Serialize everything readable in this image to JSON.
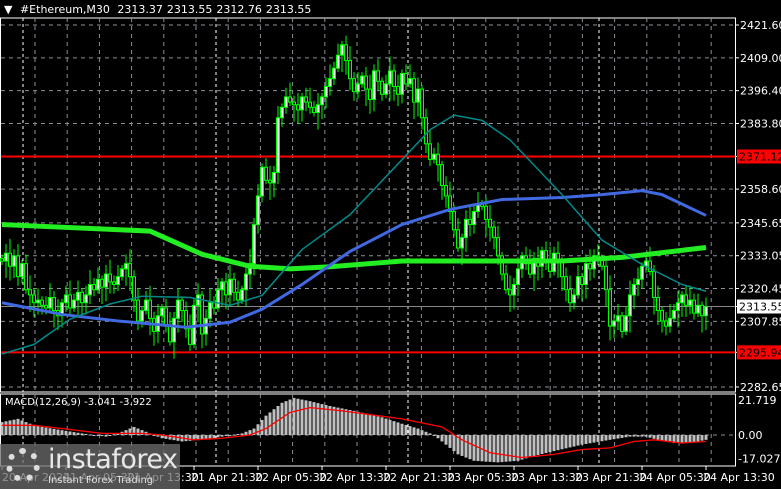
{
  "header": {
    "collapse_icon": "triangle-down-icon",
    "symbol": "#Ethereum,M30",
    "open": "2313.37",
    "high": "2313.55",
    "low": "2312.76",
    "close": "2313.55"
  },
  "watermark": {
    "brand": "instaforex",
    "tagline": "Instant Forex Trading"
  },
  "colors": {
    "bg": "#000000",
    "bull": "#00ff00",
    "ma_slow": "#22ee22",
    "ma_mid": "#4169e1",
    "ma_fast": "#008b8b",
    "level": "#ff0000",
    "hist": "#c0c0c0",
    "signal": "#ff0000",
    "grid": "#8a8f99"
  },
  "chart_data": {
    "type": "candlestick",
    "title": "#Ethereum,M30",
    "ylim": [
      2282.65,
      2421.6
    ],
    "y_ticks": [
      "2421.60",
      "2409.00",
      "2396.40",
      "2383.80",
      "2371.12",
      "2358.60",
      "2345.65",
      "2333.05",
      "2320.45",
      "2313.55",
      "2307.85",
      "2295.94",
      "2282.65"
    ],
    "y_tick_values": [
      2421.6,
      2409.0,
      2396.4,
      2383.8,
      2371.12,
      2358.6,
      2345.65,
      2333.05,
      2320.45,
      2313.55,
      2307.85,
      2295.94,
      2282.65
    ],
    "highlight_labels": {
      "2371.12": "level",
      "2295.94": "level",
      "2313.55": "price"
    },
    "levels": [
      2371.12,
      2295.94
    ],
    "current_price": 2313.55,
    "x_labels": [
      "20 Apr 2024",
      "21 Apr 05:30",
      "21 Apr 13:30",
      "21 Apr 21:30",
      "22 Apr 05:30",
      "22 Apr 13:30",
      "22 Apr 21:30",
      "23 Apr 05:30",
      "23 Apr 13:30",
      "23 Apr 21:30",
      "24 Apr 05:30",
      "24 Apr 13:30"
    ],
    "x_label_candle_index": [
      0,
      16,
      32,
      48,
      64,
      80,
      96,
      112,
      128,
      144,
      160,
      176
    ],
    "closes": [
      2331,
      2334,
      2329,
      2333,
      2325,
      2330,
      2320,
      2318,
      2315,
      2316,
      2314,
      2313,
      2317,
      2312,
      2310,
      2315,
      2318,
      2313,
      2316,
      2319,
      2315,
      2318,
      2322,
      2320,
      2324,
      2321,
      2326,
      2323,
      2322,
      2325,
      2328,
      2330,
      2325,
      2316,
      2308,
      2312,
      2316,
      2309,
      2304,
      2310,
      2313,
      2306,
      2300,
      2309,
      2316,
      2312,
      2305,
      2299,
      2314,
      2318,
      2303,
      2309,
      2315,
      2313,
      2320,
      2323,
      2318,
      2324,
      2319,
      2316,
      2320,
      2326,
      2330,
      2345,
      2356,
      2367,
      2362,
      2361,
      2365,
      2386,
      2390,
      2394,
      2392,
      2391,
      2389,
      2394,
      2392,
      2390,
      2388,
      2391,
      2394,
      2398,
      2401,
      2405,
      2410,
      2414,
      2408,
      2401,
      2396,
      2399,
      2402,
      2397,
      2393,
      2404,
      2400,
      2395,
      2399,
      2404,
      2398,
      2395,
      2403,
      2399,
      2401,
      2392,
      2397,
      2386,
      2376,
      2370,
      2372,
      2368,
      2360,
      2356,
      2350,
      2343,
      2336,
      2340,
      2347,
      2345,
      2350,
      2353,
      2352,
      2347,
      2344,
      2340,
      2333,
      2326,
      2320,
      2318,
      2322,
      2328,
      2333,
      2330,
      2326,
      2332,
      2329,
      2335,
      2331,
      2327,
      2334,
      2331,
      2325,
      2320,
      2315,
      2318,
      2325,
      2322,
      2330,
      2328,
      2333,
      2332,
      2329,
      2320,
      2306,
      2308,
      2310,
      2304,
      2310,
      2318,
      2322,
      2324,
      2329,
      2331,
      2327,
      2317,
      2312,
      2308,
      2306,
      2309,
      2312,
      2315,
      2318,
      2314,
      2316,
      2311,
      2314,
      2310,
      2313.55
    ],
    "moving_averages": [
      {
        "name": "slow",
        "points": [
          [
            0,
            2345
          ],
          [
            37,
            2342.5
          ],
          [
            50,
            2333.6
          ],
          [
            62,
            2329
          ],
          [
            72,
            2328
          ],
          [
            82,
            2328.8
          ],
          [
            100,
            2331
          ],
          [
            115,
            2331
          ],
          [
            140,
            2331
          ],
          [
            155,
            2332.4
          ],
          [
            176,
            2336.2
          ]
        ]
      },
      {
        "name": "mid",
        "points": [
          [
            0,
            2315
          ],
          [
            15,
            2310.5
          ],
          [
            29,
            2308
          ],
          [
            46,
            2305.6
          ],
          [
            57,
            2307.5
          ],
          [
            65,
            2312.5
          ],
          [
            75,
            2322
          ],
          [
            87,
            2334.7
          ],
          [
            100,
            2345
          ],
          [
            112,
            2350.8
          ],
          [
            125,
            2354.6
          ],
          [
            140,
            2355.4
          ],
          [
            150,
            2356.5
          ],
          [
            160,
            2358
          ],
          [
            165,
            2356.5
          ],
          [
            176,
            2348.5
          ]
        ]
      },
      {
        "name": "fast",
        "points": [
          [
            0,
            2295.3
          ],
          [
            8,
            2299
          ],
          [
            17,
            2308.7
          ],
          [
            27,
            2314.5
          ],
          [
            35,
            2317.5
          ],
          [
            47,
            2317
          ],
          [
            57,
            2314
          ],
          [
            65,
            2317.8
          ],
          [
            75,
            2335.4
          ],
          [
            87,
            2348.8
          ],
          [
            100,
            2369.9
          ],
          [
            107,
            2381.4
          ],
          [
            113,
            2387
          ],
          [
            120,
            2385
          ],
          [
            127,
            2377.5
          ],
          [
            140,
            2356.5
          ],
          [
            150,
            2339
          ],
          [
            160,
            2329.7
          ],
          [
            170,
            2322
          ],
          [
            176,
            2319.4
          ]
        ]
      }
    ],
    "macd": {
      "label": "MACD(12,26,9) -3.041 -3.922",
      "params": "MACD(12,26,9)",
      "main": "-3.041",
      "signal_value": "-3.922",
      "ylim": [
        -17.027,
        21.719
      ],
      "y_ticks": [
        "21.719",
        "0.00",
        "-17.027"
      ],
      "histogram_points": [
        [
          0,
          8
        ],
        [
          4,
          10
        ],
        [
          7,
          7
        ],
        [
          10,
          5
        ],
        [
          15,
          3
        ],
        [
          20,
          1
        ],
        [
          26,
          -1
        ],
        [
          30,
          2
        ],
        [
          33,
          5
        ],
        [
          36,
          2
        ],
        [
          40,
          -2
        ],
        [
          45,
          -4
        ],
        [
          50,
          -3
        ],
        [
          55,
          -1
        ],
        [
          60,
          1
        ],
        [
          63,
          4
        ],
        [
          66,
          12
        ],
        [
          70,
          20
        ],
        [
          73,
          23
        ],
        [
          77,
          21
        ],
        [
          82,
          18
        ],
        [
          88,
          15
        ],
        [
          95,
          11
        ],
        [
          100,
          7
        ],
        [
          104,
          4
        ],
        [
          108,
          0
        ],
        [
          111,
          -6
        ],
        [
          114,
          -12
        ],
        [
          118,
          -16
        ],
        [
          124,
          -17
        ],
        [
          129,
          -16
        ],
        [
          133,
          -13
        ],
        [
          138,
          -10
        ],
        [
          145,
          -6
        ],
        [
          152,
          -3
        ],
        [
          157,
          -1
        ],
        [
          161,
          -1
        ],
        [
          164,
          -3
        ],
        [
          168,
          -5
        ],
        [
          172,
          -5
        ],
        [
          176,
          -3
        ]
      ],
      "signal_points": [
        [
          0,
          6
        ],
        [
          8,
          6
        ],
        [
          15,
          4
        ],
        [
          25,
          1
        ],
        [
          35,
          1
        ],
        [
          40,
          0
        ],
        [
          48,
          -3
        ],
        [
          55,
          -2
        ],
        [
          62,
          0
        ],
        [
          66,
          4
        ],
        [
          72,
          14
        ],
        [
          77,
          17
        ],
        [
          85,
          15
        ],
        [
          100,
          10
        ],
        [
          110,
          5
        ],
        [
          115,
          -3
        ],
        [
          122,
          -11
        ],
        [
          130,
          -14
        ],
        [
          138,
          -12
        ],
        [
          145,
          -9
        ],
        [
          152,
          -8
        ],
        [
          158,
          -4
        ],
        [
          163,
          -3
        ],
        [
          170,
          -5
        ],
        [
          176,
          -4
        ]
      ]
    }
  }
}
